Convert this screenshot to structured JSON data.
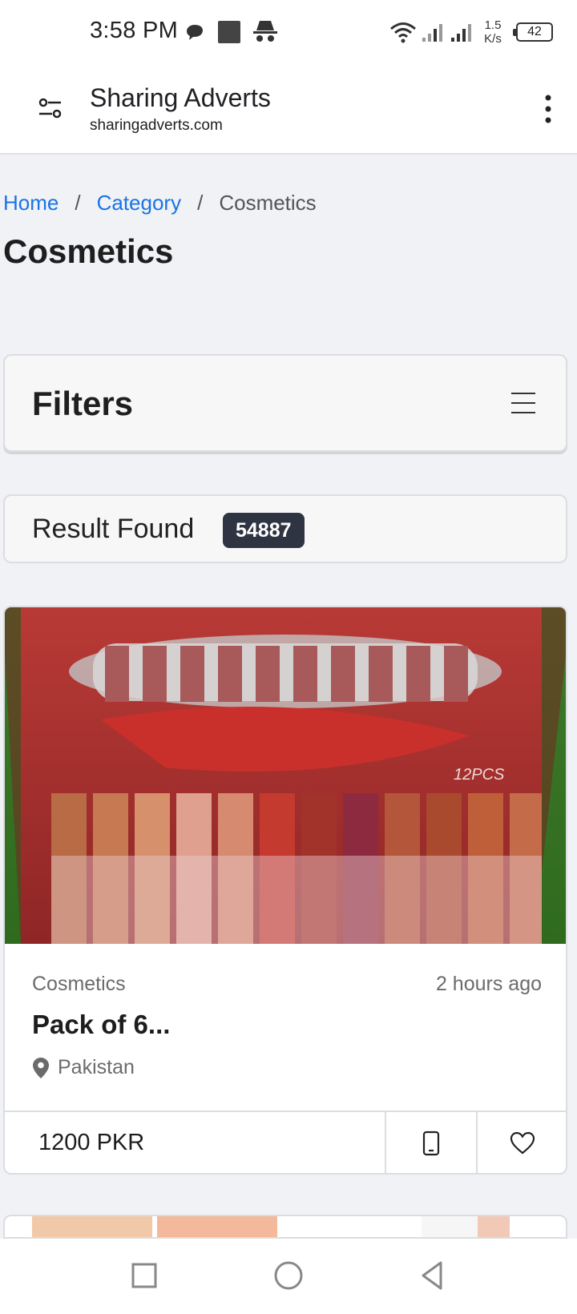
{
  "status_bar": {
    "time": "3:58 PM",
    "net_speed_value": "1.5",
    "net_speed_unit": "K/s",
    "battery": "42",
    "icons": [
      "chat-bubble-icon",
      "gallery-icon",
      "incognito-icon",
      "wifi-icon",
      "signal-icon",
      "signal-icon"
    ]
  },
  "app_bar": {
    "title": "Sharing Adverts",
    "url": "sharingadverts.com",
    "icons": [
      "tune-icon",
      "more-vert-icon"
    ]
  },
  "breadcrumb": {
    "items": [
      "Home",
      "Category",
      "Cosmetics"
    ],
    "separator": "/"
  },
  "page": {
    "title": "Cosmetics"
  },
  "filters": {
    "title": "Filters",
    "icon": "hamburger-icon"
  },
  "results": {
    "label": "Result Found",
    "count": "54887"
  },
  "listings": [
    {
      "category": "Cosmetics",
      "time": "2 hours ago",
      "title": "Pack of 6...",
      "location": "Pakistan",
      "price": "1200 PKR",
      "image_alt": "lip gloss set box with 12 tubes",
      "image_text": "12PCS",
      "actions": [
        "phone-icon",
        "heart-icon"
      ]
    }
  ],
  "colors": {
    "link": "#1a73e8",
    "badge_bg": "#2e3442",
    "page_bg": "#f0f2f5"
  }
}
